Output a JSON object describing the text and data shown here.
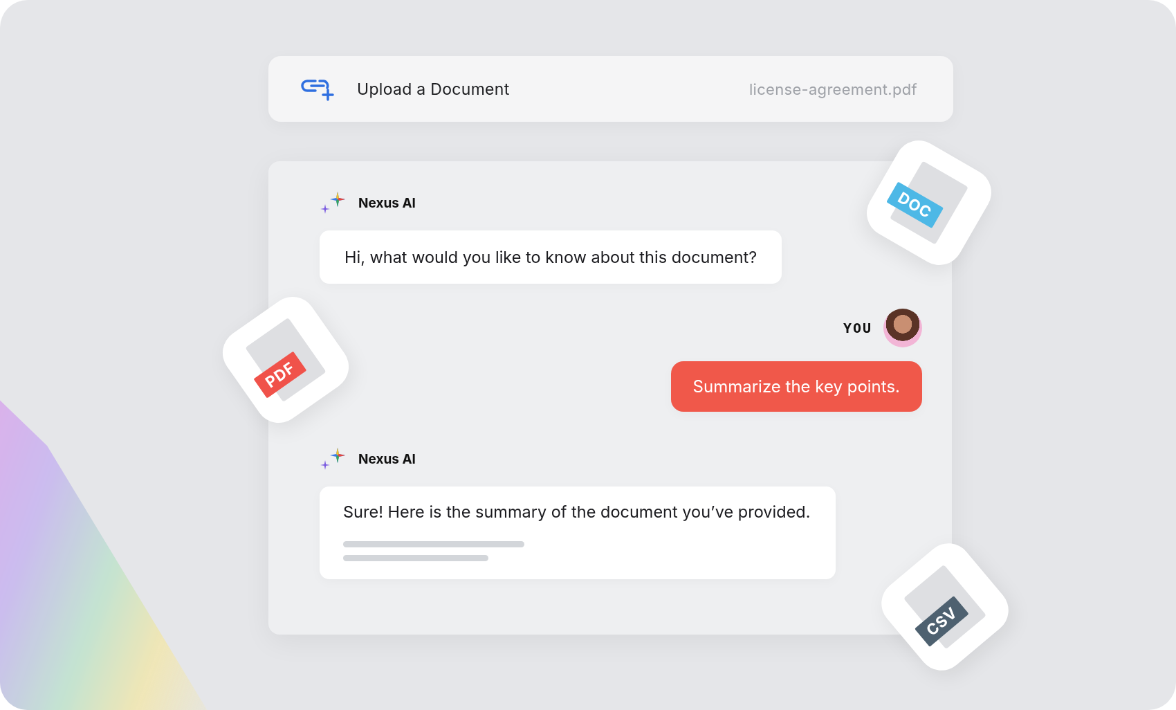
{
  "upload_bar": {
    "label": "Upload a Document",
    "filename": "license-agreement.pdf"
  },
  "messages": [
    {
      "kind": "ai",
      "sender": "Nexus AI",
      "text": "Hi, what would you like to know about this document?",
      "pending_lines": false
    },
    {
      "kind": "user",
      "sender": "YOU",
      "text": "Summarize the key points."
    },
    {
      "kind": "ai",
      "sender": "Nexus AI",
      "text": "Sure! Here is the summary of the document you’ve provided.",
      "pending_lines": true
    }
  ],
  "file_badges": [
    {
      "kind": "doc",
      "label": "DOC",
      "color": "#4db8e6"
    },
    {
      "kind": "pdf",
      "label": "PDF",
      "color": "#f0524a"
    },
    {
      "kind": "csv",
      "label": "CSV",
      "color": "#4e6170"
    }
  ]
}
